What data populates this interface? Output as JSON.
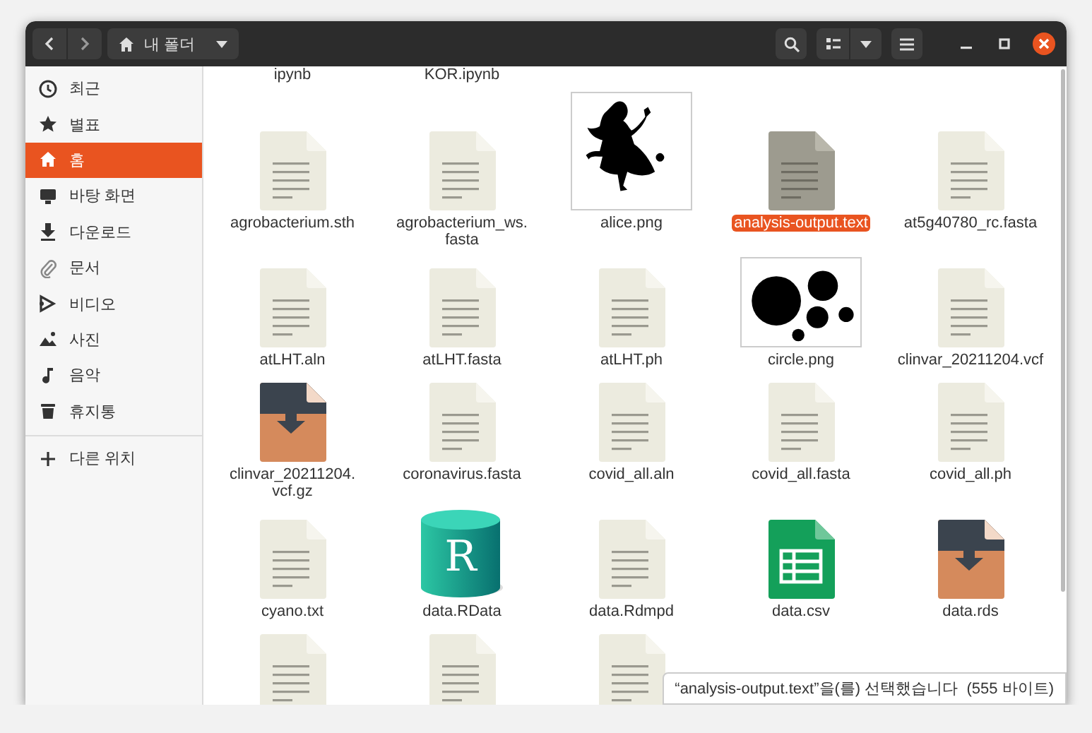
{
  "window": {
    "path_button": {
      "label": "내 폴더"
    }
  },
  "sidebar": {
    "items": [
      {
        "kind": "recent",
        "label": "최근",
        "selected": false
      },
      {
        "kind": "starred",
        "label": "별표",
        "selected": false
      },
      {
        "kind": "home",
        "label": "홈",
        "selected": true
      },
      {
        "kind": "desktop",
        "label": "바탕 화면",
        "selected": false
      },
      {
        "kind": "downloads",
        "label": "다운로드",
        "selected": false
      },
      {
        "kind": "documents",
        "label": "문서",
        "selected": false
      },
      {
        "kind": "videos",
        "label": "비디오",
        "selected": false
      },
      {
        "kind": "pictures",
        "label": "사진",
        "selected": false
      },
      {
        "kind": "music",
        "label": "음악",
        "selected": false
      },
      {
        "kind": "trash",
        "label": "휴지통",
        "selected": false
      }
    ],
    "other": {
      "kind": "add",
      "label": "다른 위치",
      "selected": false
    }
  },
  "files": {
    "cut_off_labels": [
      "ipynb",
      "KOR.ipynb"
    ],
    "items": [
      {
        "kind": "document",
        "label": "agrobacterium.sth",
        "selected": false
      },
      {
        "kind": "document",
        "label": "agrobacterium_ws.\nfasta",
        "selected": false
      },
      {
        "kind": "silhouette-image",
        "label": "alice.png",
        "selected": false
      },
      {
        "kind": "document",
        "label": "analysis-output.text",
        "selected": true
      },
      {
        "kind": "document",
        "label": "at5g40780_rc.fasta",
        "selected": false
      },
      {
        "kind": "document",
        "label": "atLHT.aln",
        "selected": false
      },
      {
        "kind": "document",
        "label": "atLHT.fasta",
        "selected": false
      },
      {
        "kind": "document",
        "label": "atLHT.ph",
        "selected": false
      },
      {
        "kind": "circles-image",
        "label": "circle.png",
        "selected": false
      },
      {
        "kind": "document",
        "label": "clinvar_20211204.vcf",
        "selected": false
      },
      {
        "kind": "archive",
        "label": "clinvar_20211204.\nvcf.gz",
        "selected": false
      },
      {
        "kind": "document",
        "label": "coronavirus.fasta",
        "selected": false
      },
      {
        "kind": "document",
        "label": "covid_all.aln",
        "selected": false
      },
      {
        "kind": "document",
        "label": "covid_all.fasta",
        "selected": false
      },
      {
        "kind": "document",
        "label": "covid_all.ph",
        "selected": false
      },
      {
        "kind": "document",
        "label": "cyano.txt",
        "selected": false
      },
      {
        "kind": "database",
        "label": "data.RData",
        "logo_text": "R",
        "selected": false
      },
      {
        "kind": "document",
        "label": "data.Rdmpd",
        "selected": false
      },
      {
        "kind": "spreadsheet",
        "label": "data.csv",
        "selected": false
      },
      {
        "kind": "archive",
        "label": "data.rds",
        "selected": false
      },
      {
        "kind": "document",
        "selected": false
      },
      {
        "kind": "document",
        "selected": false
      },
      {
        "kind": "document",
        "selected": false
      }
    ]
  },
  "status_popup": "“analysis-output.text”을(를) 선택했습니다  (555 바이트)"
}
